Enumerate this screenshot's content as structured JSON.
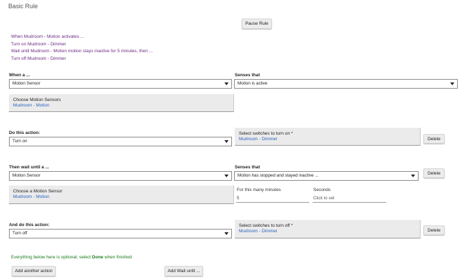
{
  "page": {
    "title": "Basic Rule"
  },
  "pause_button": "Pause Rule",
  "summary": [
    "When Mudroom - Motion activates ...",
    "Turn on Mudroom - Dimmer",
    "Wait until Mudroom - Motion motion stays inactive for 5 minutes, then ...",
    "Turn off Mudroom - Dimmer"
  ],
  "trigger": {
    "label": "When a ...",
    "device_type": "Motion Sensor",
    "senses_label": "Senses that",
    "senses_value": "Motion is active",
    "chooser_title": "Choose Motion Sensors",
    "chooser_value": "Mudroom - Motion"
  },
  "action1": {
    "label": "Do this action:",
    "value": "Turn on",
    "switch_title": "Select switches to turn on *",
    "switch_value": "Mudroom - Dimmer",
    "delete": "Delete"
  },
  "wait": {
    "label": "Then wait until a ...",
    "device_type": "Motion Sensor",
    "senses_label": "Senses that",
    "senses_value": "Motion has stopped and stayed inactive ...",
    "delete": "Delete",
    "chooser_title": "Choose a Motion Sensor",
    "chooser_value": "Mudroom - Motion",
    "minutes_label": "For this many minutes",
    "minutes_value": "5",
    "seconds_label": "Seconds",
    "seconds_placeholder": "Click to set"
  },
  "action2": {
    "label": "And do this action:",
    "value": "Turn off",
    "switch_title": "Select switches to turn off *",
    "switch_value": "Mudroom - Dimmer",
    "delete": "Delete"
  },
  "optional": {
    "prefix": "Everything below here is optional; select ",
    "bold": "Done",
    "suffix": " when finished"
  },
  "footer": {
    "add_action": "Add another action",
    "add_wait": "Add Wait until ..."
  }
}
